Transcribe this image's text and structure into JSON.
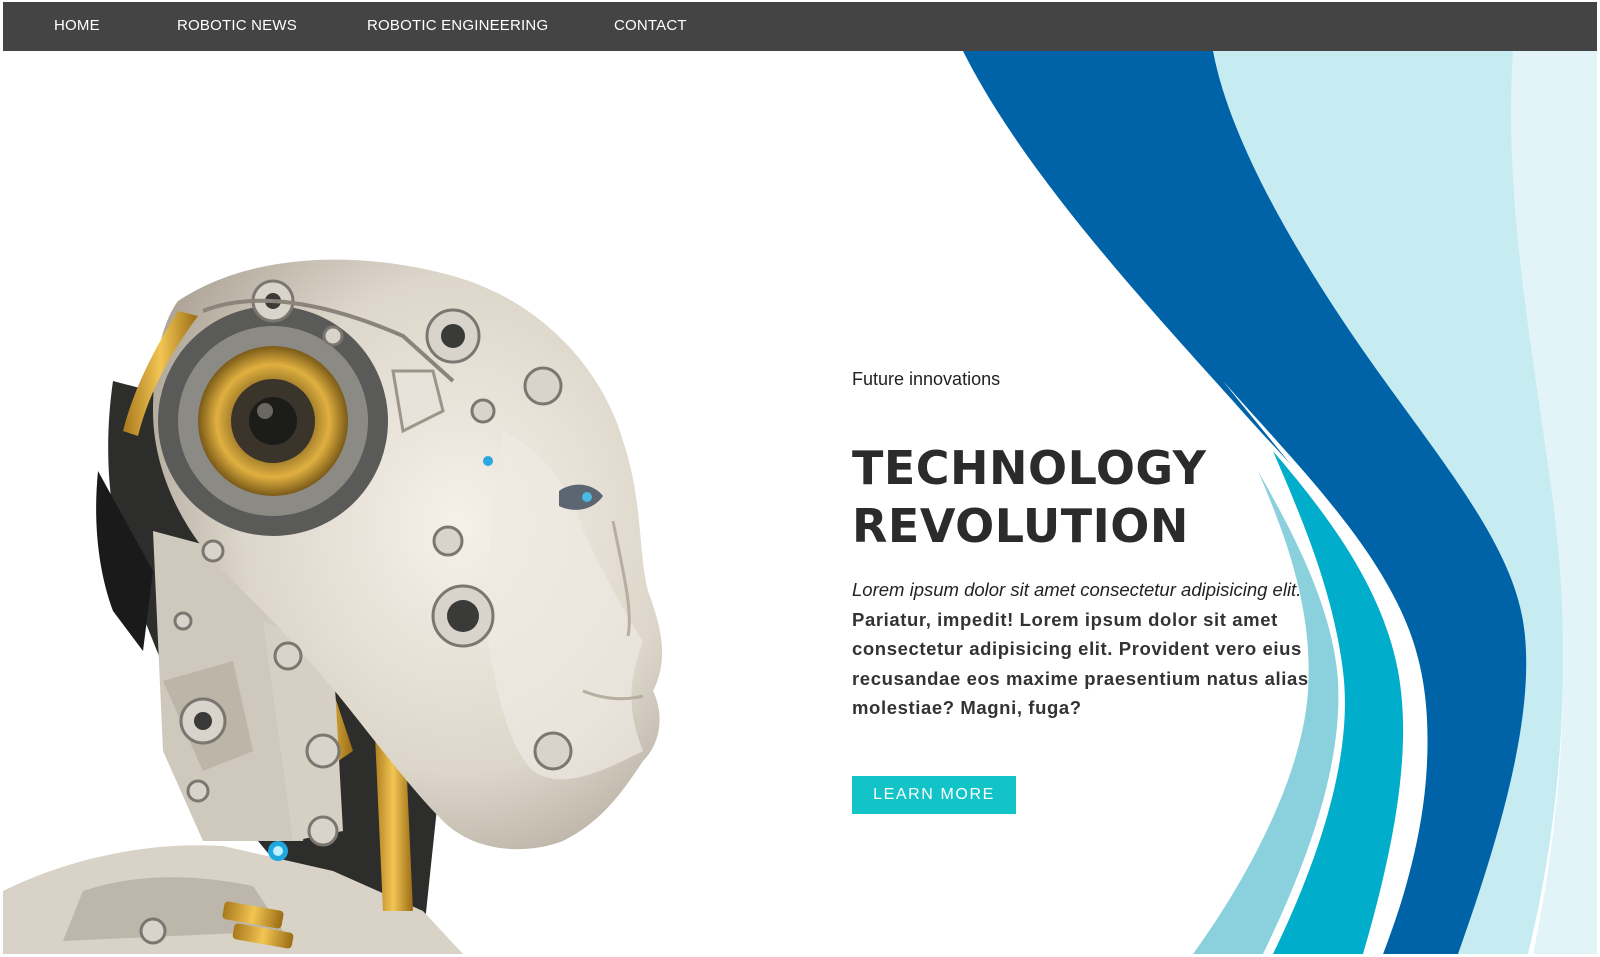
{
  "nav": {
    "items": [
      {
        "label": "HOME"
      },
      {
        "label": "ROBOTIC NEWS"
      },
      {
        "label": "ROBOTIC ENGINEERING"
      },
      {
        "label": "CONTACT"
      }
    ]
  },
  "hero": {
    "eyebrow": "Future innovations",
    "headline_line1": "TECHNOLOGY",
    "headline_line2": "REVOLUTION",
    "body_italic": "Lorem ipsum dolor sit amet consectetur adipisicing elit.",
    "body_main": "Pariatur, impedit! Lorem ipsum dolor sit amet consectetur adipisicing elit. Provident vero eius recusandae eos maxime praesentium natus alias molestiae? Magni, fuga?",
    "cta_label": "LEARN MORE",
    "image": "robot-head-profile-illustration"
  },
  "colors": {
    "navbar": "#444444",
    "accent": "#12c3c7",
    "wave_dark_blue": "#0063a8",
    "wave_teal": "#00aecb",
    "wave_light_teal": "#8bd0dd",
    "wave_pale": "#c9edf2",
    "headline": "#2b2b2b"
  }
}
